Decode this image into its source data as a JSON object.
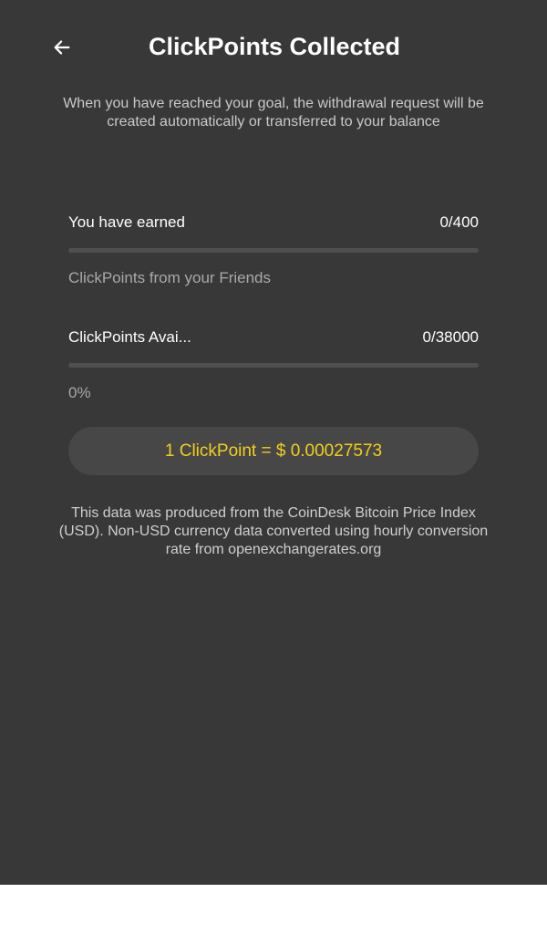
{
  "header": {
    "title": "ClickPoints Collected",
    "back_icon": "arrow-left-icon"
  },
  "subtitle": "When you have reached your goal, the withdrawal request will be created automatically or transferred to your balance",
  "earned": {
    "label": "You have earned",
    "value": "0/400",
    "progress": 0,
    "caption": "ClickPoints from your Friends"
  },
  "available": {
    "label": "ClickPoints Avai...",
    "value": "0/38000",
    "progress": 0,
    "percent_text": "0%"
  },
  "rate": {
    "text": "1 ClickPoint = $ 0.00027573"
  },
  "disclaimer": "This data was produced from the CoinDesk Bitcoin Price Index (USD). Non-USD currency data converted using hourly conversion rate from openexchangerates.org",
  "colors": {
    "background": "#383838",
    "accent": "#f2cf1c",
    "pill": "#474747",
    "track": "#4f4f4f"
  }
}
